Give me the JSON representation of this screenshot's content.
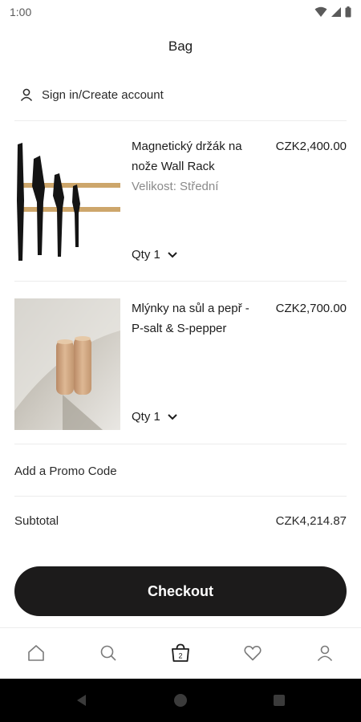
{
  "status": {
    "time": "1:00"
  },
  "header": {
    "title": "Bag"
  },
  "account": {
    "signin_label": "Sign in/Create account"
  },
  "items": [
    {
      "name": "Magnetický držák na nože Wall Rack",
      "variant": "Velikost: Střední",
      "price": "CZK2,400.00",
      "qty": "Qty 1"
    },
    {
      "name": "Mlýnky na sůl a pepř - P-salt & S-pepper",
      "variant": "",
      "price": "CZK2,700.00",
      "qty": "Qty 1"
    }
  ],
  "promo": {
    "label": "Add a Promo Code"
  },
  "summary": {
    "subtotal_label": "Subtotal",
    "subtotal_value": "CZK4,214.87"
  },
  "checkout": {
    "label": "Checkout"
  },
  "tabbar": {
    "bag_count": "2",
    "icons": [
      "home-icon",
      "search-icon",
      "bag-icon",
      "heart-icon",
      "profile-icon"
    ]
  },
  "colors": {
    "button": "#1c1b1b",
    "divider": "#ececec",
    "muted": "#8a8a8a"
  }
}
